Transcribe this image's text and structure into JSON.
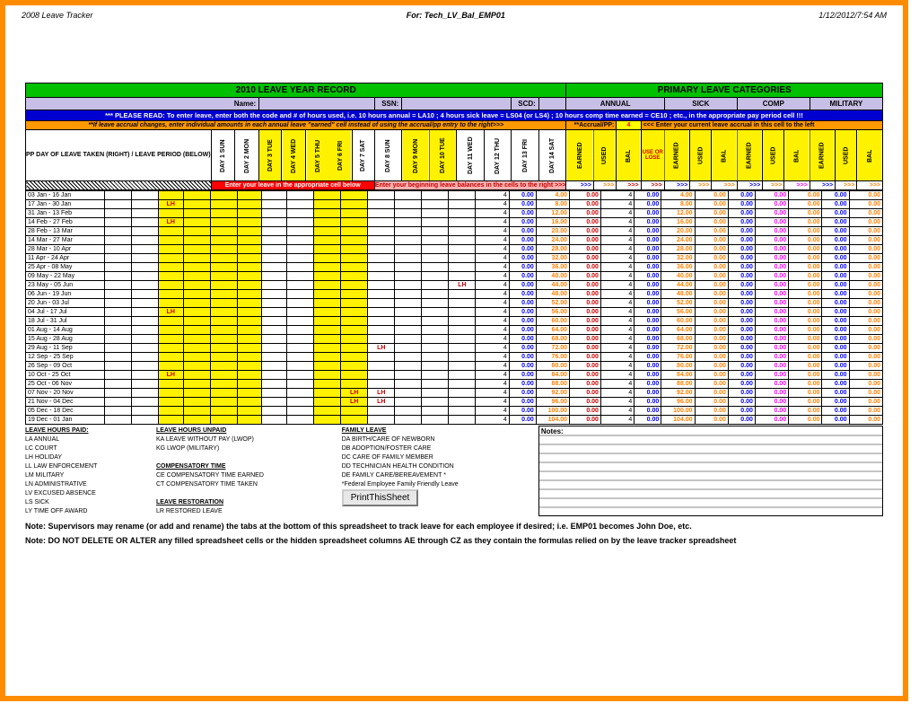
{
  "header": {
    "left": "2008 Leave Tracker",
    "center": "For: Tech_LV_Bal_EMP01",
    "right": "1/12/2012/7:54 AM"
  },
  "titles": {
    "year": "2010 LEAVE YEAR RECORD",
    "primary": "PRIMARY LEAVE CATEGORIES"
  },
  "info": {
    "name": "Name:",
    "ssn": "SSN:",
    "scd": "SCD:"
  },
  "cats": {
    "annual": "ANNUAL",
    "sick": "SICK",
    "comp": "COMP",
    "military": "MILITARY"
  },
  "please": "*** PLEASE READ: To enter leave, enter both the code and # of hours used, i.e. 10 hours annual = LA10 ; 4 hours sick leave = LS04 (or LS4) ; 10 hours comp time earned = CE10 ; etc., in the appropriate pay period cell !!!",
  "accrual": {
    "note": "**If leave accrual changes, enter individual amounts in each  annual leave \"earned\"  cell instead of using the accrual/pp entry to the right>>>",
    "label": "**Accrual/PP:",
    "val": "4",
    "hint": "<<< Enter your current leave accrual in this cell to the left"
  },
  "days": [
    "DAY 1  SUN",
    "DAY 2  MON",
    "DAY 3  TUE",
    "DAY 4  WED",
    "DAY 5  THU",
    "DAY 6  FRI",
    "DAY 7  SAT",
    "DAY 8  SUN",
    "DAY 9  MON",
    "DAY 10  TUE",
    "DAY 11  WED",
    "DAY 12  THU",
    "DAY 13  FRI",
    "DAY 14  SAT"
  ],
  "catcols": [
    "EARNED",
    "USED",
    "BAL",
    "USE OR LOSE",
    "EARNED",
    "USED",
    "BAL",
    "EARNED",
    "USED",
    "BAL",
    "EARNED",
    "USED",
    "BAL"
  ],
  "pp": "PP DAY OF LEAVE TAKEN (RIGHT) / LEAVE PERIOD (BELOW)",
  "inst1": "Enter your leave in the appropriate cell below",
  "inst2": "Enter your beginning leave balances in the cells to the right  >>>",
  "periods": [
    "03 Jan - 16 Jan",
    "17 Jan - 30 Jan",
    "31 Jan - 13 Feb",
    "14 Feb - 27 Feb",
    "28 Feb - 13 Mar",
    "14 Mar - 27 Mar",
    "28 Mar - 10 Apr",
    "11 Apr - 24 Apr",
    "25 Apr - 08 May",
    "09 May - 22 May",
    "23 May - 05 Jun",
    "06 Jun - 19 Jun",
    "20 Jun - 03 Jul",
    "04 Jul - 17 Jul",
    "18 Jul - 31 Jul",
    "01 Aug - 14 Aug",
    "15 Aug - 28 Aug",
    "29 Aug - 11 Sep",
    "12 Sep - 25 Sep",
    "26 Sep - 09 Oct",
    "10 Oct - 25 Oct",
    "25 Oct - 06 Nov",
    "07 Nov - 20 Nov",
    "21 Nov - 04 Dec",
    "05 Dec - 18 Dec",
    "19 Dec - 01 Jan"
  ],
  "lh": {
    "1": [
      2
    ],
    "3": [
      2
    ],
    "10": [
      13
    ],
    "13": [
      2
    ],
    "17": [
      10
    ],
    "20": [
      2
    ],
    "22": [
      9,
      10
    ],
    "23": [
      9,
      10
    ]
  },
  "bals": [
    "4.00",
    "8.00",
    "12.00",
    "16.00",
    "20.00",
    "24.00",
    "28.00",
    "32.00",
    "36.00",
    "40.00",
    "44.00",
    "48.00",
    "52.00",
    "56.00",
    "60.00",
    "64.00",
    "68.00",
    "72.00",
    "76.00",
    "80.00",
    "84.00",
    "88.00",
    "92.00",
    "96.00",
    "100.00",
    "104.00"
  ],
  "legend": {
    "lhp": "LEAVE HOURS PAID:",
    "lhu": "LEAVE HOURS UNPAID",
    "fl": "FAMILY LEAVE",
    "notes": "Notes:",
    "la": "LA    ANNUAL",
    "lc": "LC    COURT",
    "lhh": "LH    HOLIDAY",
    "ll": "LL    LAW ENFORCEMENT",
    "lm": "LM    MILITARY",
    "ln": "LN    ADMINISTRATIVE",
    "lv": "LV    EXCUSED ABSENCE",
    "ls": "LS    SICK",
    "ly": "LY    TIME OFF AWARD",
    "ka": "KA       LEAVE WITHOUT PAY (LWOP)",
    "kg": "KG       LWOP (MILITARY)",
    "ct": "COMPENSATORY TIME",
    "ce": "CE        COMPENSATORY TIME EARNED",
    "ctt": "CT        COMPENSATORY TIME TAKEN",
    "lr": "LEAVE RESTORATION",
    "lrr": "LR        RESTORED LEAVE",
    "da": "DA       BIRTH/CARE OF NEWBORN",
    "db": "DB       ADOPTION/FOSTER CARE",
    "dc": "DC       CARE OF FAMILY MEMBER",
    "dd": "DD       TECHNICIAN HEALTH CONDITION",
    "de": "DE        FAMILY CARE/BEREAVEMENT *",
    "fe": "*Federal Employee Family Friendly Leave",
    "btn": "PrintThisSheet"
  },
  "notes": {
    "n1": "Note:  Supervisors may rename (or add and rename) the tabs at the bottom of this spreadsheet to track leave for each employee if desired;  i.e. EMP01 becomes John Doe, etc.",
    "n2": "Note:  DO NOT DELETE OR ALTER any filled spreadsheet cells or the hidden spreadsheet columns AE through CZ as they contain the formulas relied on by the leave tracker spreadsheet"
  }
}
